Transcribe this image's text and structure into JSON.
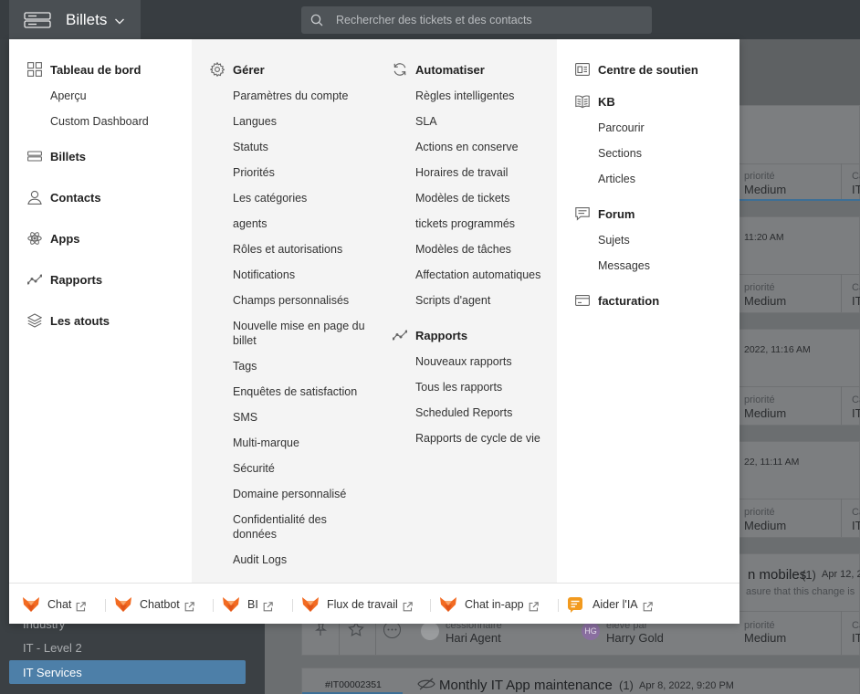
{
  "topbar": {
    "module_title": "Billets",
    "search_placeholder": "Rechercher des tickets et des contacts"
  },
  "menu": {
    "col1": {
      "dashboard": {
        "label": "Tableau de bord",
        "items": [
          "Aperçu",
          "Custom Dashboard"
        ]
      },
      "tickets": "Billets",
      "contacts": "Contacts",
      "apps": "Apps",
      "reports": "Rapports",
      "assets": "Les atouts"
    },
    "col2": {
      "heading": "Gérer",
      "items": [
        "Paramètres du compte",
        "Langues",
        "Statuts",
        "Priorités",
        "Les catégories",
        "agents",
        "Rôles et autorisations",
        "Notifications",
        "Champs personnalisés",
        "Nouvelle mise en page du billet",
        "Tags",
        "Enquêtes de satisfaction",
        "SMS",
        "Multi-marque",
        "Sécurité",
        "Domaine personnalisé",
        "Confidentialité des données",
        "Audit Logs"
      ]
    },
    "col3": {
      "automate": {
        "heading": "Automatiser",
        "items": [
          "Règles intelligentes",
          "SLA",
          "Actions en conserve",
          "Horaires de travail",
          "Modèles de tickets",
          "tickets programmés",
          "Modèles de tâches",
          "Affectation automatiques",
          "Scripts d'agent"
        ]
      },
      "reports": {
        "heading": "Rapports",
        "items": [
          "Nouveaux rapports",
          "Tous les rapports",
          "Scheduled Reports",
          "Rapports de cycle de vie"
        ]
      }
    },
    "col4": {
      "support_center": "Centre de soutien",
      "kb": {
        "heading": "KB",
        "items": [
          "Parcourir",
          "Sections",
          "Articles"
        ]
      },
      "forum": {
        "heading": "Forum",
        "items": [
          "Sujets",
          "Messages"
        ]
      },
      "billing": "facturation"
    },
    "footer": [
      {
        "label": "Chat",
        "icon": "fox-logo-icon"
      },
      {
        "label": "Chatbot",
        "icon": "fox-logo-icon"
      },
      {
        "label": "BI",
        "icon": "fox-logo-icon"
      },
      {
        "label": "Flux de travail",
        "icon": "fox-logo-icon"
      },
      {
        "label": "Chat in-app",
        "icon": "fox-logo-icon"
      },
      {
        "label": "Aider l'IA",
        "icon": "ai-chat-icon"
      }
    ]
  },
  "background": {
    "sidebar": {
      "items": [
        "Industry",
        "IT - Level 2",
        "IT Services"
      ]
    },
    "cards": [
      {
        "priority_label": "priorité",
        "priority": "Medium"
      },
      {
        "time": "11:20 AM",
        "priority_label": "priorité",
        "priority": "Medium"
      },
      {
        "time": "2022, 11:16 AM",
        "priority_label": "priorité",
        "priority": "Medium"
      },
      {
        "time": "22, 11:11 AM",
        "priority_label": "priorité",
        "priority": "Medium"
      },
      {
        "title": "n mobiles",
        "count": "(1)",
        "date": "Apr 12, 20",
        "snippet": "asure that this change is",
        "assignee_label": "cessionnaire",
        "assignee": "Hari Agent",
        "raised_label": "élevé par",
        "raised_by": "Harry Gold",
        "raised_initials": "HG",
        "priority_label": "priorité",
        "priority": "Medium"
      },
      {
        "ticket_id": "#IT00002351",
        "title": "Monthly IT App maintenance",
        "count": "(1)",
        "date": "Apr 8, 2022, 9:20 PM"
      }
    ],
    "cut_col_label": "Ca",
    "cut_col_value": "IT"
  },
  "colors": {
    "accent": "#4d7fa8",
    "fox_orange": "#f26b22",
    "ai_orange": "#f29a1e"
  }
}
